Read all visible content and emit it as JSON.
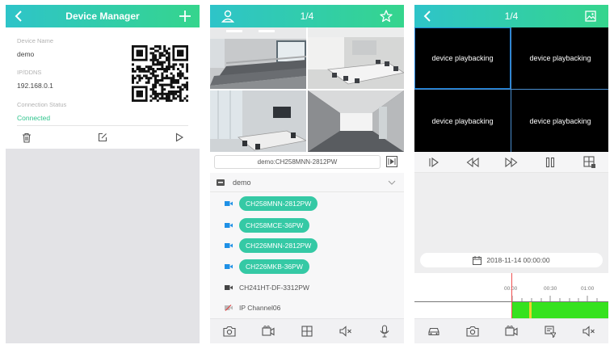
{
  "device_manager": {
    "title": "Device Manager",
    "device_name_label": "Device Name",
    "device_name": "demo",
    "ip_label": "IP/DDNS",
    "ip": "192.168.0.1",
    "status_label": "Connection Status",
    "status": "Connected",
    "accent_color": "#2fc48d"
  },
  "live_view": {
    "page_indicator": "1/4",
    "search_value": "demo:CH258MNN-2812PW",
    "device_group": "demo",
    "channels": [
      {
        "name": "CH258MNN-2812PW",
        "state": "online-selected"
      },
      {
        "name": "CH258MCE-36PW",
        "state": "online-selected"
      },
      {
        "name": "CH226MNN-2812PW",
        "state": "online-selected"
      },
      {
        "name": "CH226MKB-36PW",
        "state": "online-selected"
      },
      {
        "name": "CH241HT-DF-3312PW",
        "state": "online"
      },
      {
        "name": "IP Channel06",
        "state": "offline"
      }
    ],
    "toolbar_icons": [
      "camera-icon",
      "video-record-icon",
      "grid-icon",
      "mute-icon",
      "microphone-icon"
    ]
  },
  "playback": {
    "page_indicator": "1/4",
    "cells": [
      "device playbacking",
      "device playbacking",
      "device playbacking",
      "device playbacking"
    ],
    "date": "2018-11-14 00:00:00",
    "timeline_labels": [
      "00:00",
      "00:30",
      "01:00"
    ],
    "recording_color": "#36e21f",
    "toolbar_icons": [
      "car-icon",
      "camera-icon",
      "video-record-icon",
      "filter-icon",
      "mute-icon"
    ]
  },
  "header_gradient": [
    "#2ec4c9",
    "#35d58d"
  ]
}
